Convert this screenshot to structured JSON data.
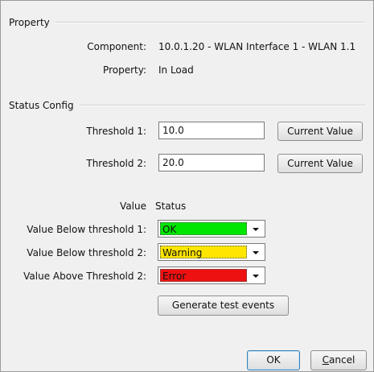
{
  "property_section": {
    "title": "Property",
    "component_label": "Component:",
    "component_value": "10.0.1.20 - WLAN Interface 1 - WLAN 1.1",
    "property_label": "Property:",
    "property_value": "In Load"
  },
  "status_config": {
    "title": "Status Config",
    "threshold1_label": "Threshold 1:",
    "threshold1_value": "10.0",
    "threshold2_label": "Threshold 2:",
    "threshold2_value": "20.0",
    "current_value_label": "Current Value",
    "value_header": "Value",
    "status_header": "Status",
    "rows": [
      {
        "label": "Value Below threshold 1:",
        "selected": "OK",
        "color": "#00e600"
      },
      {
        "label": "Value Below threshold 2:",
        "selected": "Warning",
        "color": "#ffe600"
      },
      {
        "label": "Value Above Threshold 2:",
        "selected": "Error",
        "color": "#ee1111"
      }
    ],
    "generate_label": "Generate test events"
  },
  "footer": {
    "ok_label": "OK",
    "cancel_label": "Cancel"
  },
  "icons": [
    "chevron-down-icon"
  ]
}
